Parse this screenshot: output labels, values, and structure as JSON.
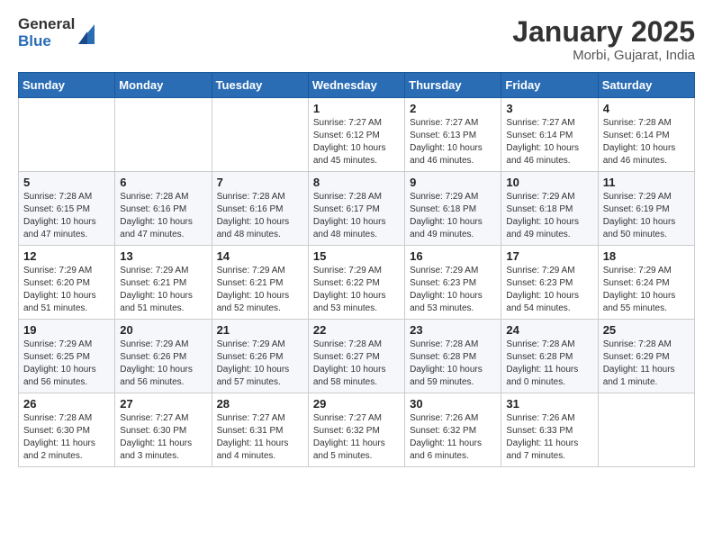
{
  "logo": {
    "general": "General",
    "blue": "Blue"
  },
  "header": {
    "title": "January 2025",
    "subtitle": "Morbi, Gujarat, India"
  },
  "weekdays": [
    "Sunday",
    "Monday",
    "Tuesday",
    "Wednesday",
    "Thursday",
    "Friday",
    "Saturday"
  ],
  "weeks": [
    [
      {
        "day": "",
        "info": ""
      },
      {
        "day": "",
        "info": ""
      },
      {
        "day": "",
        "info": ""
      },
      {
        "day": "1",
        "info": "Sunrise: 7:27 AM\nSunset: 6:12 PM\nDaylight: 10 hours\nand 45 minutes."
      },
      {
        "day": "2",
        "info": "Sunrise: 7:27 AM\nSunset: 6:13 PM\nDaylight: 10 hours\nand 46 minutes."
      },
      {
        "day": "3",
        "info": "Sunrise: 7:27 AM\nSunset: 6:14 PM\nDaylight: 10 hours\nand 46 minutes."
      },
      {
        "day": "4",
        "info": "Sunrise: 7:28 AM\nSunset: 6:14 PM\nDaylight: 10 hours\nand 46 minutes."
      }
    ],
    [
      {
        "day": "5",
        "info": "Sunrise: 7:28 AM\nSunset: 6:15 PM\nDaylight: 10 hours\nand 47 minutes."
      },
      {
        "day": "6",
        "info": "Sunrise: 7:28 AM\nSunset: 6:16 PM\nDaylight: 10 hours\nand 47 minutes."
      },
      {
        "day": "7",
        "info": "Sunrise: 7:28 AM\nSunset: 6:16 PM\nDaylight: 10 hours\nand 48 minutes."
      },
      {
        "day": "8",
        "info": "Sunrise: 7:28 AM\nSunset: 6:17 PM\nDaylight: 10 hours\nand 48 minutes."
      },
      {
        "day": "9",
        "info": "Sunrise: 7:29 AM\nSunset: 6:18 PM\nDaylight: 10 hours\nand 49 minutes."
      },
      {
        "day": "10",
        "info": "Sunrise: 7:29 AM\nSunset: 6:18 PM\nDaylight: 10 hours\nand 49 minutes."
      },
      {
        "day": "11",
        "info": "Sunrise: 7:29 AM\nSunset: 6:19 PM\nDaylight: 10 hours\nand 50 minutes."
      }
    ],
    [
      {
        "day": "12",
        "info": "Sunrise: 7:29 AM\nSunset: 6:20 PM\nDaylight: 10 hours\nand 51 minutes."
      },
      {
        "day": "13",
        "info": "Sunrise: 7:29 AM\nSunset: 6:21 PM\nDaylight: 10 hours\nand 51 minutes."
      },
      {
        "day": "14",
        "info": "Sunrise: 7:29 AM\nSunset: 6:21 PM\nDaylight: 10 hours\nand 52 minutes."
      },
      {
        "day": "15",
        "info": "Sunrise: 7:29 AM\nSunset: 6:22 PM\nDaylight: 10 hours\nand 53 minutes."
      },
      {
        "day": "16",
        "info": "Sunrise: 7:29 AM\nSunset: 6:23 PM\nDaylight: 10 hours\nand 53 minutes."
      },
      {
        "day": "17",
        "info": "Sunrise: 7:29 AM\nSunset: 6:23 PM\nDaylight: 10 hours\nand 54 minutes."
      },
      {
        "day": "18",
        "info": "Sunrise: 7:29 AM\nSunset: 6:24 PM\nDaylight: 10 hours\nand 55 minutes."
      }
    ],
    [
      {
        "day": "19",
        "info": "Sunrise: 7:29 AM\nSunset: 6:25 PM\nDaylight: 10 hours\nand 56 minutes."
      },
      {
        "day": "20",
        "info": "Sunrise: 7:29 AM\nSunset: 6:26 PM\nDaylight: 10 hours\nand 56 minutes."
      },
      {
        "day": "21",
        "info": "Sunrise: 7:29 AM\nSunset: 6:26 PM\nDaylight: 10 hours\nand 57 minutes."
      },
      {
        "day": "22",
        "info": "Sunrise: 7:28 AM\nSunset: 6:27 PM\nDaylight: 10 hours\nand 58 minutes."
      },
      {
        "day": "23",
        "info": "Sunrise: 7:28 AM\nSunset: 6:28 PM\nDaylight: 10 hours\nand 59 minutes."
      },
      {
        "day": "24",
        "info": "Sunrise: 7:28 AM\nSunset: 6:28 PM\nDaylight: 11 hours\nand 0 minutes."
      },
      {
        "day": "25",
        "info": "Sunrise: 7:28 AM\nSunset: 6:29 PM\nDaylight: 11 hours\nand 1 minute."
      }
    ],
    [
      {
        "day": "26",
        "info": "Sunrise: 7:28 AM\nSunset: 6:30 PM\nDaylight: 11 hours\nand 2 minutes."
      },
      {
        "day": "27",
        "info": "Sunrise: 7:27 AM\nSunset: 6:30 PM\nDaylight: 11 hours\nand 3 minutes."
      },
      {
        "day": "28",
        "info": "Sunrise: 7:27 AM\nSunset: 6:31 PM\nDaylight: 11 hours\nand 4 minutes."
      },
      {
        "day": "29",
        "info": "Sunrise: 7:27 AM\nSunset: 6:32 PM\nDaylight: 11 hours\nand 5 minutes."
      },
      {
        "day": "30",
        "info": "Sunrise: 7:26 AM\nSunset: 6:32 PM\nDaylight: 11 hours\nand 6 minutes."
      },
      {
        "day": "31",
        "info": "Sunrise: 7:26 AM\nSunset: 6:33 PM\nDaylight: 11 hours\nand 7 minutes."
      },
      {
        "day": "",
        "info": ""
      }
    ]
  ]
}
